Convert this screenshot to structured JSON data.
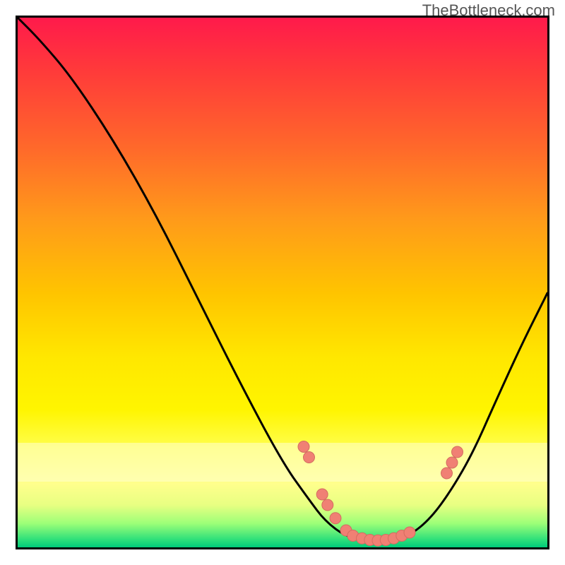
{
  "watermark": "TheBottleneck.com",
  "colors": {
    "frame": "#000000",
    "curve": "#000000",
    "dot_fill": "#f08074",
    "dot_stroke": "#d46c60"
  },
  "chart_data": {
    "type": "line",
    "title": "",
    "xlabel": "",
    "ylabel": "",
    "xlim": [
      0,
      100
    ],
    "ylim": [
      0,
      100
    ],
    "curve": [
      {
        "x": 0,
        "y": 100
      },
      {
        "x": 4,
        "y": 96
      },
      {
        "x": 10,
        "y": 89
      },
      {
        "x": 18,
        "y": 77
      },
      {
        "x": 26,
        "y": 63
      },
      {
        "x": 34,
        "y": 47
      },
      {
        "x": 42,
        "y": 31
      },
      {
        "x": 50,
        "y": 16
      },
      {
        "x": 55,
        "y": 9
      },
      {
        "x": 58,
        "y": 5
      },
      {
        "x": 62,
        "y": 2
      },
      {
        "x": 66,
        "y": 1.2
      },
      {
        "x": 70,
        "y": 1.2
      },
      {
        "x": 74,
        "y": 2.2
      },
      {
        "x": 78,
        "y": 5.5
      },
      {
        "x": 82,
        "y": 11
      },
      {
        "x": 86,
        "y": 18
      },
      {
        "x": 90,
        "y": 27
      },
      {
        "x": 95,
        "y": 38
      },
      {
        "x": 100,
        "y": 48
      }
    ],
    "dots": [
      {
        "x": 54,
        "y": 19
      },
      {
        "x": 55,
        "y": 17
      },
      {
        "x": 57.5,
        "y": 10
      },
      {
        "x": 58.5,
        "y": 8
      },
      {
        "x": 60,
        "y": 5.5
      },
      {
        "x": 62,
        "y": 3.2
      },
      {
        "x": 63.3,
        "y": 2.2
      },
      {
        "x": 65,
        "y": 1.7
      },
      {
        "x": 66.5,
        "y": 1.4
      },
      {
        "x": 68,
        "y": 1.3
      },
      {
        "x": 69.5,
        "y": 1.4
      },
      {
        "x": 71,
        "y": 1.7
      },
      {
        "x": 72.5,
        "y": 2.2
      },
      {
        "x": 74,
        "y": 2.8
      },
      {
        "x": 81,
        "y": 14
      },
      {
        "x": 82,
        "y": 16
      },
      {
        "x": 83,
        "y": 18
      }
    ]
  }
}
